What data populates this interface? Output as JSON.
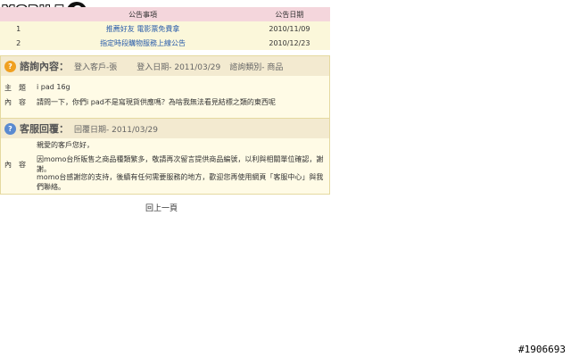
{
  "brand": {
    "logo_text": "MOBILE"
  },
  "notice": {
    "headers": {
      "title": "公告事項",
      "date": "公告日期"
    },
    "rows": [
      {
        "num": "1",
        "title": "推薦好友 電影票免費拿",
        "date": "2010/11/09"
      },
      {
        "num": "2",
        "title": "指定時段購物服務上線公告",
        "date": "2010/12/23"
      }
    ]
  },
  "inquiry": {
    "heading": "諮詢內容：",
    "customer": "登入客戶-張",
    "login_date": "登入日期- 2011/03/29",
    "category": "諮詢類別- 商品",
    "subject_label": "主　題",
    "subject": "i pad 16g",
    "content_label": "內　容",
    "content": "請問一下，你們i pad不是寫現貨供應嗎？為啥我無法看見結標之類的東西呢"
  },
  "reply": {
    "heading": "客服回覆：",
    "reply_date": "回覆日期- 2011/03/29",
    "content_label": "內　容",
    "greeting": "親愛的客戶您好，",
    "line1": "因momo台所販售之商品種類繁多，敬請再次留言提供商品編號，以利與相關單位確認，謝謝。",
    "line2": "momo台感謝您的支持，後續有任何需要服務的地方，歡迎您再使用網頁「客服中心」與我們聯絡。"
  },
  "footer": {
    "back_label": "回上一頁"
  },
  "watermark": "#1906693",
  "colors": {
    "notice_header": "#f4d6dc",
    "panel_bg": "#fffbe6",
    "inquiry_icon": "#f0a020",
    "reply_icon": "#5a8ad0",
    "link": "#2a5caa"
  }
}
